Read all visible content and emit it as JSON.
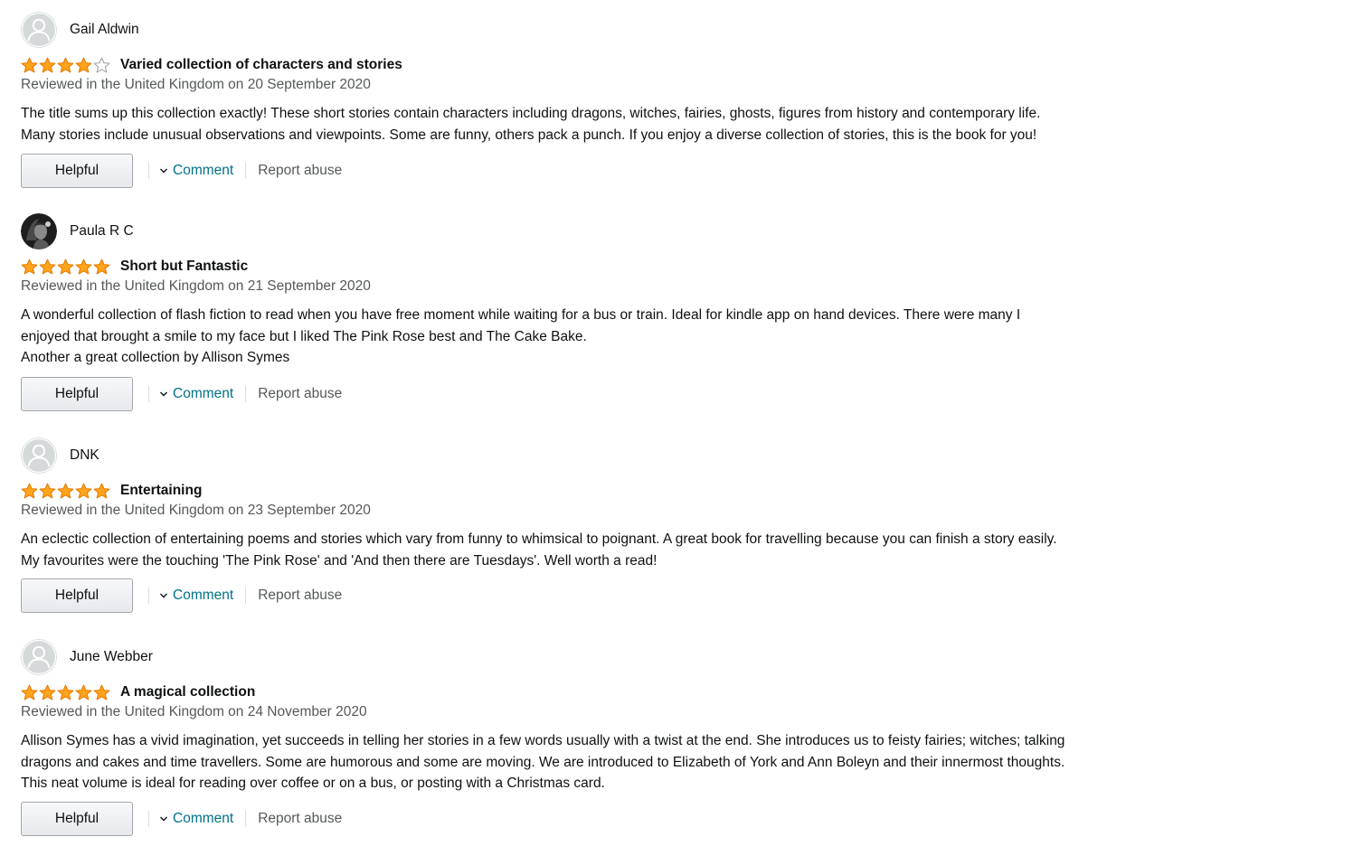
{
  "colors": {
    "star": "#FFA41C",
    "link": "#007185",
    "muted": "#565959",
    "text": "#0F1111"
  },
  "reviews": [
    {
      "name": "Gail Aldwin",
      "avatar": "default-avatar-icon",
      "rating": 4,
      "title": "Varied collection of characters and stories",
      "date": "Reviewed in the United Kingdom on 20 September 2020",
      "body": [
        "The title sums up this collection exactly! These short stories contain characters including dragons, witches, fairies, ghosts, figures from history and contemporary life.",
        "Many stories include unusual observations and viewpoints. Some are funny, others pack a punch. If you enjoy a diverse collection of stories, this is the book for you!"
      ],
      "helpful_label": "Helpful",
      "comment_label": "Comment",
      "report_label": "Report abuse"
    },
    {
      "name": "Paula R C",
      "avatar": "photo-avatar",
      "rating": 5,
      "title": "Short but Fantastic",
      "date": "Reviewed in the United Kingdom on 21 September 2020",
      "body": [
        "A wonderful collection of flash fiction to read when you have free moment while waiting for a bus or train. Ideal for kindle app on hand devices. There were many I",
        "enjoyed that brought a smile to my face but I liked The Pink Rose best and The Cake Bake.",
        "Another a great collection by Allison Symes"
      ],
      "helpful_label": "Helpful",
      "comment_label": "Comment",
      "report_label": "Report abuse"
    },
    {
      "name": "DNK",
      "avatar": "default-avatar-icon",
      "rating": 5,
      "title": "Entertaining",
      "date": "Reviewed in the United Kingdom on 23 September 2020",
      "body": [
        "An eclectic collection of entertaining poems and stories which vary from funny to whimsical to poignant. A great book for travelling because you can finish a story easily.",
        "My favourites were the touching 'The Pink Rose' and 'And then there are Tuesdays'. Well worth a read!"
      ],
      "helpful_label": "Helpful",
      "comment_label": "Comment",
      "report_label": "Report abuse"
    },
    {
      "name": "June Webber",
      "avatar": "default-avatar-icon",
      "rating": 5,
      "title": "A magical collection",
      "date": "Reviewed in the United Kingdom on 24 November 2020",
      "body": [
        "Allison Symes has a vivid imagination, yet succeeds in telling her stories in a few words usually with a twist at the end. She introduces us to feisty fairies; witches; talking",
        "dragons and cakes and time travellers. Some are humorous and some are moving. We are introduced to Elizabeth of York and Ann Boleyn and their innermost thoughts.",
        "This neat volume is ideal for reading over coffee or on a bus, or posting with a Christmas card."
      ],
      "helpful_label": "Helpful",
      "comment_label": "Comment",
      "report_label": "Report abuse"
    }
  ]
}
